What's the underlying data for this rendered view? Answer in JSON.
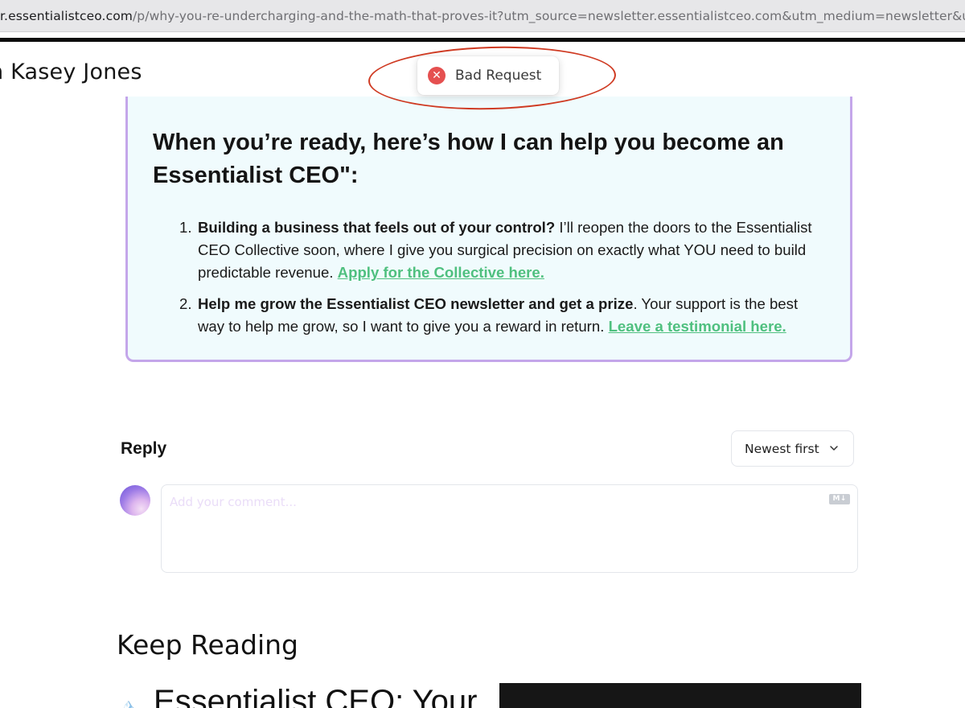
{
  "browser": {
    "url_host": "r.essentialistceo.com",
    "url_path": "/p/why-you-re-undercharging-and-the-math-that-proves-it?utm_source=newsletter.essentialistceo.com&utm_medium=newsletter&utm"
  },
  "header": {
    "author_name": "n Kasey Jones"
  },
  "toast": {
    "message": "Bad Request",
    "icon": "error-x-icon"
  },
  "cta": {
    "heading": "When you’re ready, here’s how I can help you become an Essentialist CEO\":",
    "items": [
      {
        "number": "1.",
        "bold": "Building a business that feels out of your control?",
        "text": " I’ll reopen the doors to the Essentialist CEO Collective soon, where I give you surgical precision on exactly what YOU need to build predictable revenue. ",
        "link": "Apply for the Collective here."
      },
      {
        "number": "2.",
        "bold": "Help me grow the Essentialist CEO newsletter and get a prize",
        "text": ". Your support is the best way to help me grow, so I want to give you a reward in return. ",
        "link": "Leave a testimonial here."
      }
    ]
  },
  "reply": {
    "title": "Reply",
    "sort_selected": "Newest first",
    "comment_placeholder": "Add your comment...",
    "markdown_badge": "M↓"
  },
  "keep_reading": {
    "title": "Keep Reading",
    "first_article_icon": "🏔️",
    "first_article_title": "Essentialist CEO: Your"
  },
  "colors": {
    "link_green": "#4fc07f",
    "cta_border": "#c4a6ea",
    "cta_background": "#f0fbfd",
    "error_red": "#e55050",
    "annotation_red": "#cf3a22"
  }
}
